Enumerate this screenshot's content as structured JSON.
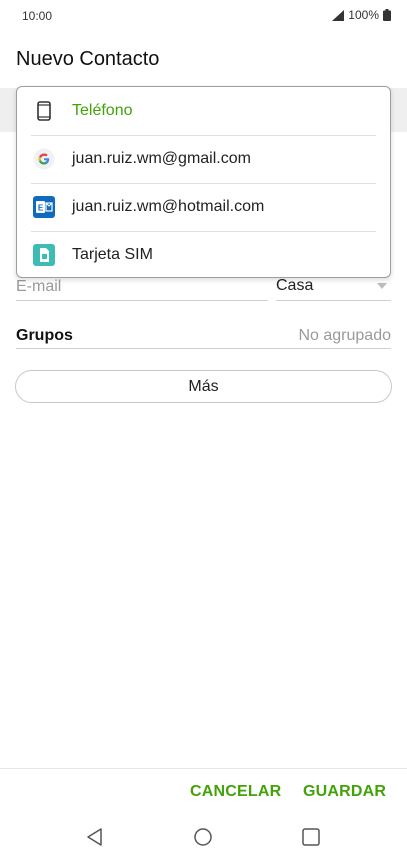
{
  "status_bar": {
    "time": "10:00",
    "battery": "100%"
  },
  "page": {
    "title": "Nuevo Contacto"
  },
  "account_dropdown": {
    "items": [
      {
        "label": "Teléfono",
        "icon": "phone-icon",
        "selected": true
      },
      {
        "label": "juan.ruiz.wm@gmail.com",
        "icon": "google-icon",
        "selected": false
      },
      {
        "label": "juan.ruiz.wm@hotmail.com",
        "icon": "outlook-icon",
        "selected": false
      },
      {
        "label": "Tarjeta SIM",
        "icon": "sim-card-icon",
        "selected": false
      }
    ]
  },
  "email_field": {
    "placeholder": "E-mail",
    "type_value": "Casa"
  },
  "groups": {
    "label": "Grupos",
    "value": "No agrupado"
  },
  "more_button": {
    "label": "Más"
  },
  "actions": {
    "cancel": "CANCELAR",
    "save": "GUARDAR"
  },
  "colors": {
    "accent": "#43a20a",
    "divider": "#cfcfcf",
    "hint": "#9a9a9a"
  }
}
